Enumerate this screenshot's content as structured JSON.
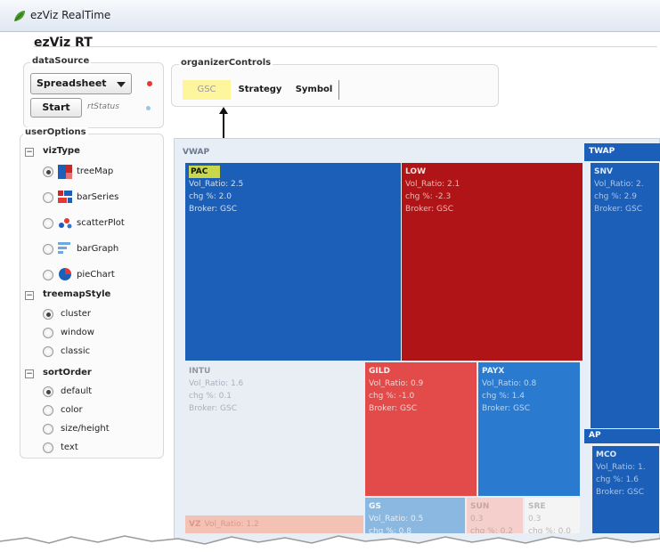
{
  "window": {
    "title": "ezViz RealTime"
  },
  "app": {
    "title": "ezViz RT"
  },
  "dataSource": {
    "title": "dataSource",
    "selected": "Spreadsheet",
    "start_label": "Start",
    "status_label": "rtStatus",
    "status_color": "#e53935"
  },
  "organizerControls": {
    "title": "organizerControls",
    "items": [
      "GSC",
      "Strategy",
      "Symbol"
    ],
    "highlight_color": "#fff59d"
  },
  "userOptions": {
    "title": "userOptions",
    "vizType": {
      "label": "vizType",
      "options": [
        {
          "label": "treeMap",
          "icon": "treemap-icon",
          "selected": true
        },
        {
          "label": "barSeries",
          "icon": "bar-series-icon",
          "selected": false
        },
        {
          "label": "scatterPlot",
          "icon": "scatter-plot-icon",
          "selected": false
        },
        {
          "label": "barGraph",
          "icon": "bar-graph-icon",
          "selected": false
        },
        {
          "label": "pieChart",
          "icon": "pie-chart-icon",
          "selected": false
        }
      ]
    },
    "treemapStyle": {
      "label": "treemapStyle",
      "options": [
        {
          "label": "cluster",
          "selected": true
        },
        {
          "label": "window",
          "selected": false
        },
        {
          "label": "classic",
          "selected": false
        }
      ]
    },
    "sortOrder": {
      "label": "sortOrder",
      "options": [
        {
          "label": "default",
          "selected": true
        },
        {
          "label": "color",
          "selected": false
        },
        {
          "label": "size/height",
          "selected": false
        },
        {
          "label": "text",
          "selected": false
        }
      ]
    }
  },
  "treemap": {
    "groups": {
      "vwap": "VWAP",
      "twap": "TWAP",
      "ap": "AP"
    },
    "cells": {
      "pac": {
        "name": "PAC",
        "l1": "Vol_Ratio: 2.5",
        "l2": "chg %: 2.0",
        "l3": "Broker: GSC",
        "color": "#1b5fb8"
      },
      "low": {
        "name": "LOW",
        "l1": "Vol_Ratio: 2.1",
        "l2": "chg %: -2.3",
        "l3": "Broker: GSC",
        "color": "#b01417"
      },
      "snv": {
        "name": "SNV",
        "l1": "Vol_Ratio: 2.",
        "l2": "chg %: 2.9",
        "l3": "Broker: GSC",
        "color": "#1b5fb8"
      },
      "intu": {
        "name": "INTU",
        "l1": "Vol_Ratio: 1.6",
        "l2": "chg %: 0.1",
        "l3": "Broker: GSC",
        "color": "#e9eef4"
      },
      "gild": {
        "name": "GILD",
        "l1": "Vol_Ratio: 0.9",
        "l2": "chg %: -1.0",
        "l3": "Broker: GSC",
        "color": "#e34a4a"
      },
      "payx": {
        "name": "PAYX",
        "l1": "Vol_Ratio: 0.8",
        "l2": "chg %: 1.4",
        "l3": "Broker: GSC",
        "color": "#2a7ad0"
      },
      "mco": {
        "name": "MCO",
        "l1": "Vol_Ratio: 1.",
        "l2": "chg %: 1.6",
        "l3": "Broker: GSC",
        "color": "#1b5fb8"
      },
      "gs": {
        "name": "GS",
        "l1": "Vol_Ratio: 0.5",
        "l2": "chg %: 0.8",
        "color": "#8ab8e0"
      },
      "sun": {
        "name": "SUN",
        "l1": "0.3",
        "l2": "chg %: 0.2",
        "color": "#f5cfcb"
      },
      "sre": {
        "name": "SRE",
        "l1": "0.3",
        "l2": "chg %: 0.0",
        "color": "#f4f4f4"
      },
      "vz": {
        "name": "VZ",
        "l1": "Vol_Ratio: 1.2",
        "color": "#f4c1b5"
      }
    }
  }
}
